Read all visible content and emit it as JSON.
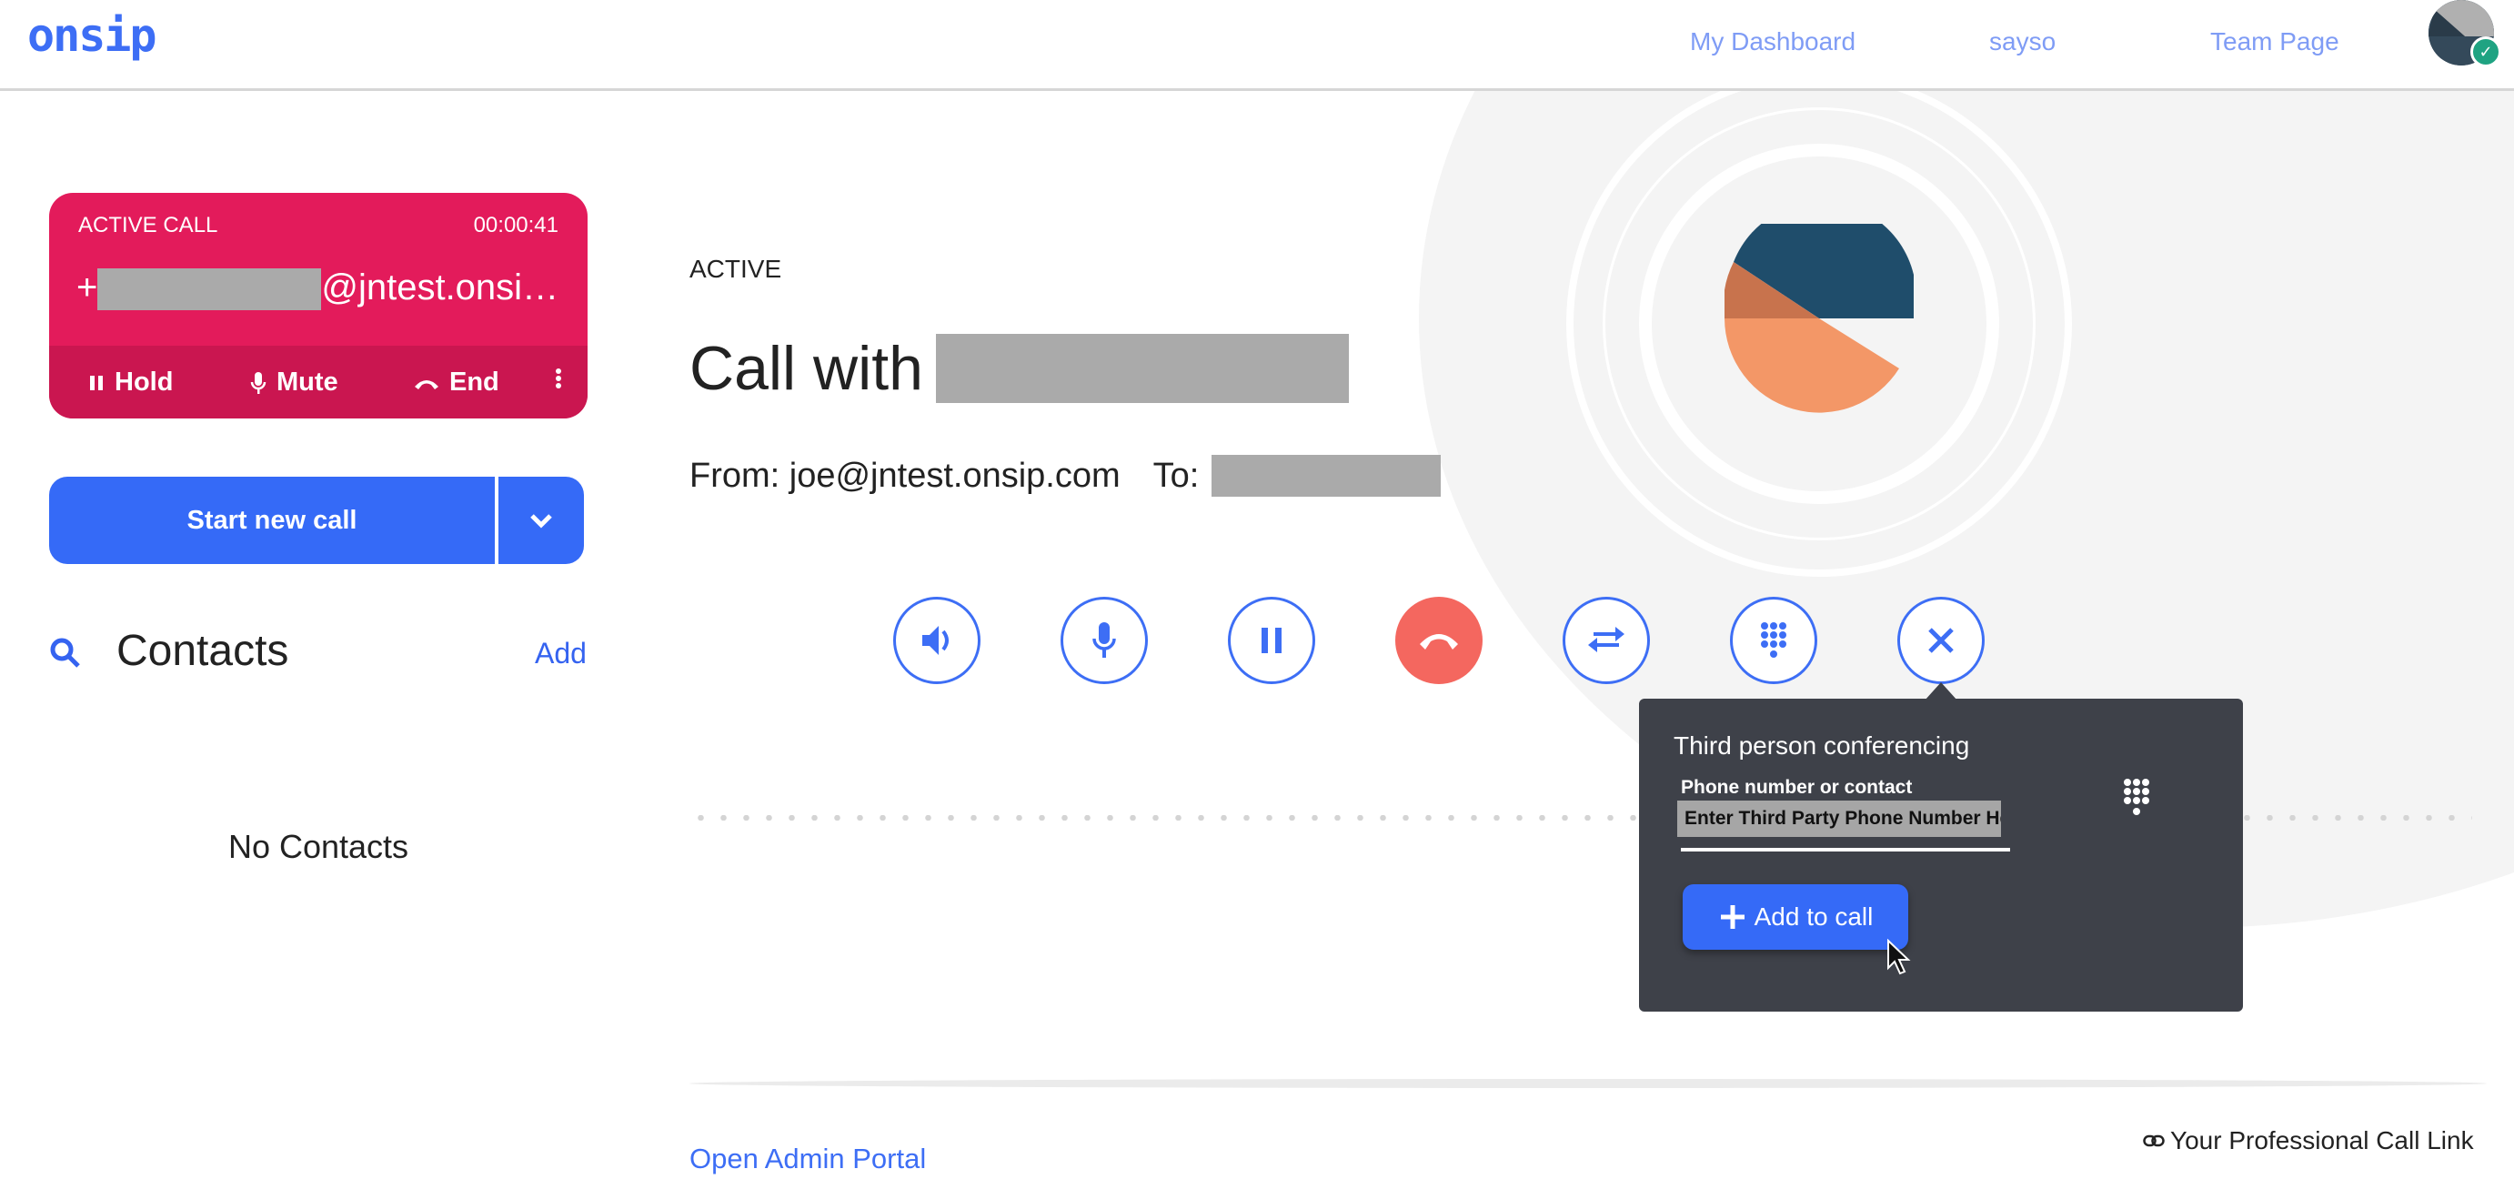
{
  "header": {
    "logo": "onsip",
    "nav": [
      {
        "label": "My Dashboard"
      },
      {
        "label": "sayso"
      },
      {
        "label": "Team Page"
      }
    ],
    "avatar_status": "available"
  },
  "active_call_card": {
    "label": "ACTIVE CALL",
    "timer": "00:00:41",
    "number_prefix": "+",
    "number_suffix": "@jntest.onsi…",
    "actions": [
      {
        "label": "Hold",
        "icon": "pause-icon"
      },
      {
        "label": "Mute",
        "icon": "mic-icon"
      },
      {
        "label": "End",
        "icon": "hangup-icon"
      }
    ],
    "more_icon": "more-vertical-icon"
  },
  "start_call": {
    "label": "Start new call",
    "dropdown_icon": "chevron-down-icon"
  },
  "contacts": {
    "title": "Contacts",
    "add_label": "Add",
    "empty_text": "No Contacts"
  },
  "call": {
    "status": "ACTIVE",
    "title_prefix": "Call with",
    "from_label": "From: joe@jntest.onsip.com",
    "to_label": "To:"
  },
  "controls": [
    {
      "name": "speaker-button",
      "icon": "speaker-icon"
    },
    {
      "name": "mute-button",
      "icon": "mic-icon"
    },
    {
      "name": "hold-button",
      "icon": "pause-icon"
    },
    {
      "name": "end-call-button",
      "icon": "hangup-icon"
    },
    {
      "name": "transfer-button",
      "icon": "transfer-icon"
    },
    {
      "name": "dialpad-button",
      "icon": "dialpad-icon"
    },
    {
      "name": "close-conference-button",
      "icon": "close-icon"
    }
  ],
  "conference_popup": {
    "title": "Third person conferencing",
    "field_label": "Phone number or contact",
    "field_value": "Enter Third Party Phone Number Here",
    "add_button_label": "Add to call"
  },
  "footer": {
    "admin_link": "Open Admin Portal",
    "call_link": "Your Professional Call Link"
  },
  "colors": {
    "brand_blue": "#356af7",
    "active_call_red": "#e31b5b",
    "end_call_red": "#f4675f",
    "popup_bg": "#3e4149"
  }
}
